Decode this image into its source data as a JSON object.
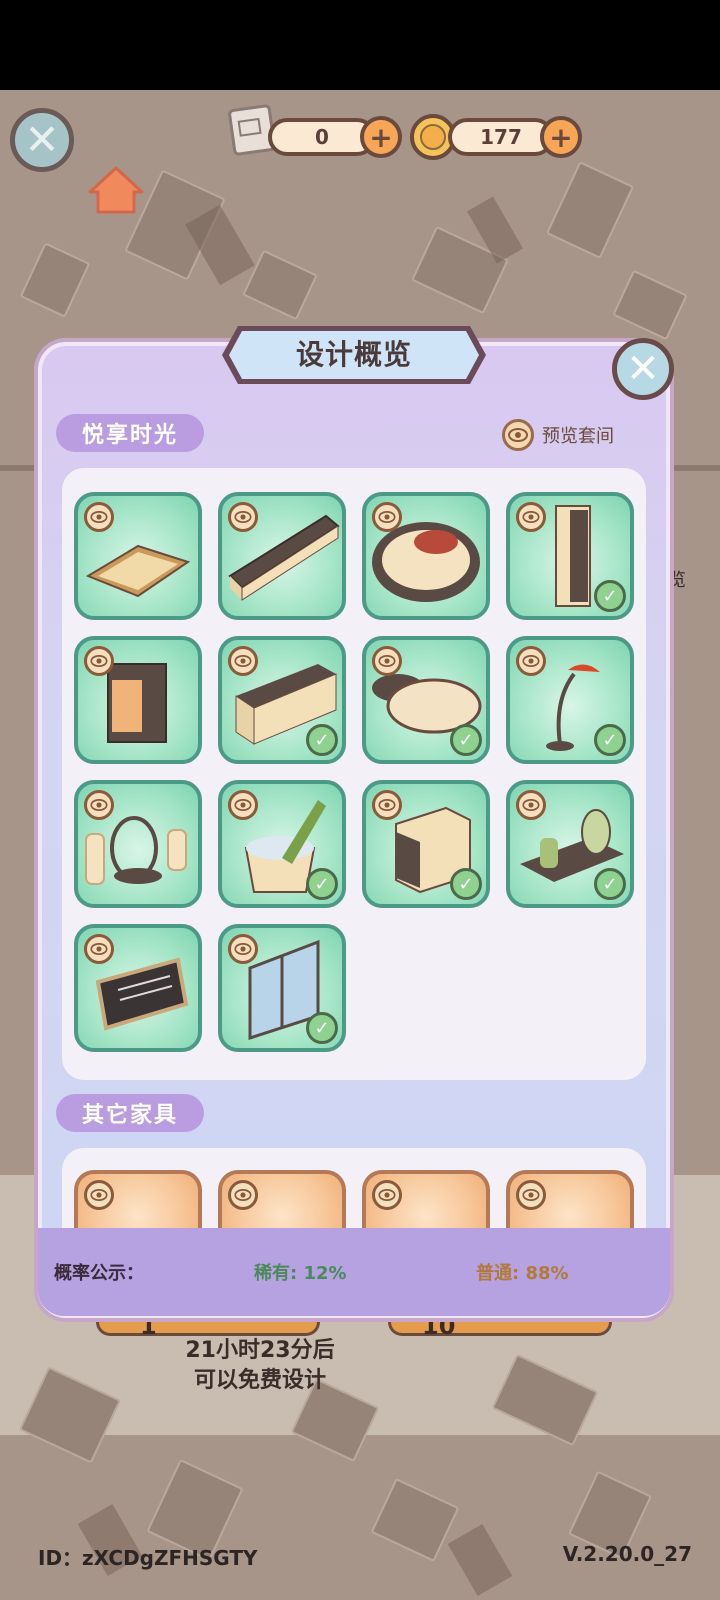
{
  "topbar": {
    "scroll_count": "0",
    "coin_count": "177",
    "plus_glyph": "+",
    "close_glyph": "✕"
  },
  "modal": {
    "title": "设计概览",
    "close_glyph": "✕",
    "section1_label": "悦享时光",
    "preview_suite_label": "预览套间",
    "section2_label": "其它家具"
  },
  "items": [
    {
      "name": "rug",
      "owned": false
    },
    {
      "name": "tv-cabinet",
      "owned": false
    },
    {
      "name": "round-bed",
      "owned": false
    },
    {
      "name": "air-purifier",
      "owned": true
    },
    {
      "name": "hotpot-cart",
      "owned": false
    },
    {
      "name": "sideboard",
      "owned": true
    },
    {
      "name": "coffee-table",
      "owned": true
    },
    {
      "name": "floor-lamp",
      "owned": true
    },
    {
      "name": "candles",
      "owned": false
    },
    {
      "name": "champagne-bucket",
      "owned": true
    },
    {
      "name": "mini-fridge",
      "owned": true
    },
    {
      "name": "aroma-tray",
      "owned": true
    },
    {
      "name": "menu-board",
      "owned": false
    },
    {
      "name": "window",
      "owned": true
    }
  ],
  "probability": {
    "label": "概率公示：",
    "rare": "稀有: 12%",
    "common": "普通: 88%"
  },
  "free_design": {
    "line1": "21小时23分后",
    "line2": "可以免费设计"
  },
  "draw_buttons": {
    "single": "1",
    "ten": "10"
  },
  "side_partial_text": "览",
  "footer": {
    "id": "ID：zXCDgZFHSGTY",
    "version": "V.2.20.0_27"
  },
  "colors": {
    "accent_orange": "#f6a656",
    "tag_purple": "#b99de0",
    "rare_green": "#4a8a5a",
    "common_orange": "#b27a3a"
  }
}
